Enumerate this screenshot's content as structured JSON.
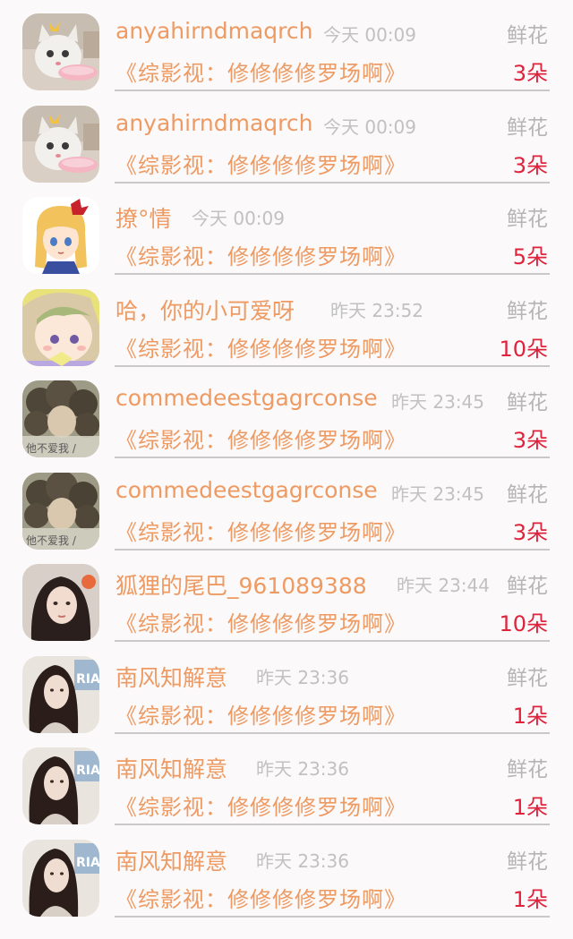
{
  "colors": {
    "name": "#ee9a63",
    "title": "#ee9a63",
    "time": "#c1c1c1",
    "gift_label": "#b5b5b5",
    "count": "#e0233d",
    "background": "#fbf9f9"
  },
  "records": [
    {
      "avatar": "cat-avatar",
      "name": "anyahirndmaqrch",
      "time": "今天 00:09",
      "gift": "鲜花",
      "title": "《综影视：修修修修罗场啊》",
      "count": "3朵"
    },
    {
      "avatar": "cat-avatar",
      "name": "anyahirndmaqrch",
      "time": "今天 00:09",
      "gift": "鲜花",
      "title": "《综影视：修修修修罗场啊》",
      "count": "3朵"
    },
    {
      "avatar": "anime-girl-avatar",
      "name": "撩°情",
      "time": "今天 00:09",
      "gift": "鲜花",
      "title": "《综影视：修修修修罗场啊》",
      "count": "5朵"
    },
    {
      "avatar": "anime-baby-avatar",
      "name": "哈，你的小可爱呀",
      "time": "昨天 23:52",
      "gift": "鲜花",
      "title": "《综影视：修修修修罗场啊》",
      "count": "10朵"
    },
    {
      "avatar": "curly-hair-avatar",
      "avatar_text": "他不爱我 /",
      "name": "commedeestgagrconse",
      "time": "昨天 23:45",
      "gift": "鲜花",
      "title": "《综影视：修修修修罗场啊》",
      "count": "3朵"
    },
    {
      "avatar": "curly-hair-avatar",
      "avatar_text": "他不爱我 /",
      "name": "commedeestgagrconse",
      "time": "昨天 23:45",
      "gift": "鲜花",
      "title": "《综影视：修修修修罗场啊》",
      "count": "3朵"
    },
    {
      "avatar": "girl-photo-avatar",
      "name": "狐狸的尾巴_961089388",
      "time": "昨天 23:44",
      "gift": "鲜花",
      "title": "《综影视：修修修修罗场啊》",
      "count": "10朵"
    },
    {
      "avatar": "long-hair-avatar",
      "name": "南风知解意",
      "time": "昨天 23:36",
      "gift": "鲜花",
      "title": "《综影视：修修修修罗场啊》",
      "count": "1朵"
    },
    {
      "avatar": "long-hair-avatar",
      "name": "南风知解意",
      "time": "昨天 23:36",
      "gift": "鲜花",
      "title": "《综影视：修修修修罗场啊》",
      "count": "1朵"
    },
    {
      "avatar": "long-hair-avatar",
      "name": "南风知解意",
      "time": "昨天 23:36",
      "gift": "鲜花",
      "title": "《综影视：修修修修罗场啊》",
      "count": "1朵"
    }
  ]
}
